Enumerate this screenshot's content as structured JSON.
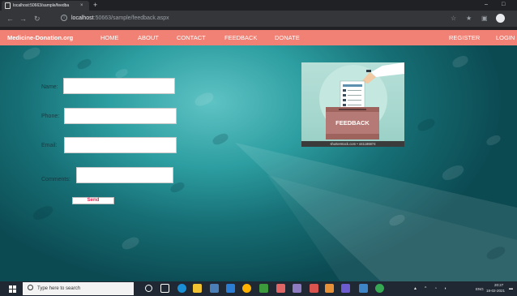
{
  "browser": {
    "tab_title": "localhost:50663/sample/feedba",
    "tab_close": "×",
    "new_tab": "+",
    "url_host": "localhost",
    "url_path": ":50663/sample/feedback.aspx",
    "window_minimize": "–",
    "window_maximize": "□"
  },
  "navbar": {
    "brand": "Medicine-Donation.org",
    "links": [
      "HOME",
      "ABOUT",
      "CONTACT",
      "FEEDBACK",
      "DONATE"
    ],
    "register": "REGISTER",
    "login": "LOGIN",
    "color": "#f08174"
  },
  "form": {
    "name_label": "Name:",
    "phone_label": "Phone:",
    "email_label": "Email:",
    "comments_label": "Comments:",
    "name_value": "",
    "phone_value": "",
    "email_value": "",
    "comments_value": "",
    "send_label": "Send"
  },
  "image": {
    "box_label": "FEEDBACK",
    "caption": "shutterstock.com • 441186874"
  },
  "taskbar": {
    "search_placeholder": "Type here to search",
    "language": "ENG",
    "time": "20:27",
    "date": "18-02-2021"
  }
}
